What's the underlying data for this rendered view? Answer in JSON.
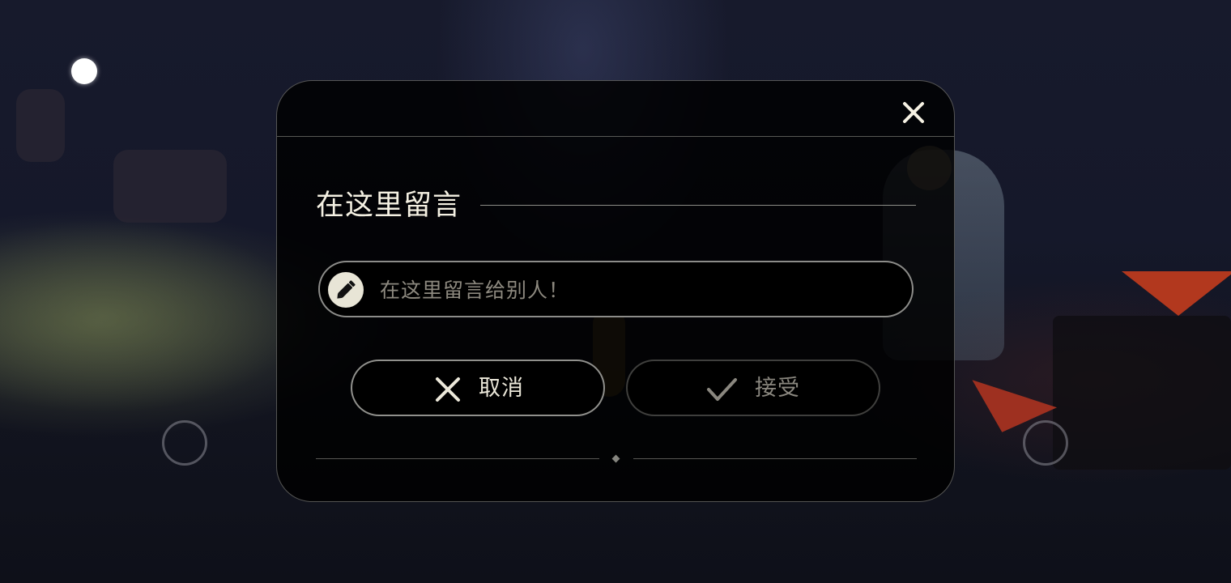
{
  "dialog": {
    "title": "在这里留言",
    "input_placeholder": "在这里留言给别人！",
    "input_value": "",
    "cancel_label": "取消",
    "accept_label": "接受"
  },
  "icons": {
    "close": "close-icon",
    "pencil": "pencil-icon",
    "cancel": "x-icon",
    "accept": "checkmark-icon"
  },
  "colors": {
    "dialog_background": "#000000",
    "text_primary": "#f4f0e2",
    "text_disabled": "#8a877f",
    "pencil_badge": "#e8e5d6"
  }
}
